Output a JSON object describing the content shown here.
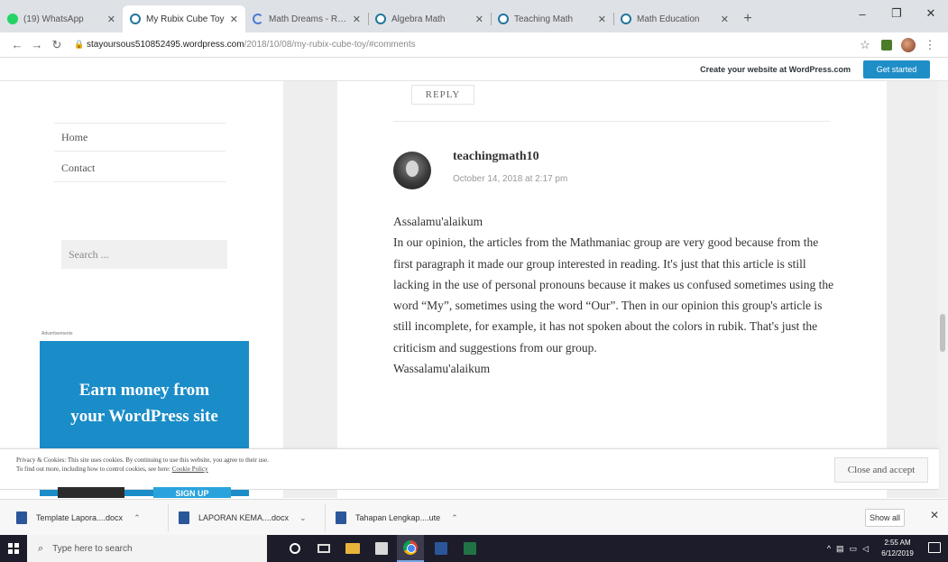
{
  "browser": {
    "tabs": [
      {
        "label": "(19) WhatsApp",
        "icon": "whatsapp-icon",
        "active": false
      },
      {
        "label": "My Rubix Cube Toy",
        "icon": "wordpress-icon",
        "active": true
      },
      {
        "label": "Math Dreams - Result",
        "icon": "loading-icon",
        "active": false
      },
      {
        "label": "Algebra Math",
        "icon": "wordpress-icon",
        "active": false
      },
      {
        "label": "Teaching Math",
        "icon": "wordpress-icon",
        "active": false
      },
      {
        "label": "Math Education",
        "icon": "wordpress-icon",
        "active": false
      }
    ],
    "url_host": "stayoursous510852495.wordpress.com",
    "url_path": "/2018/10/08/my-rubix-cube-toy/#comments"
  },
  "wpbar": {
    "cta": "Create your website at WordPress.com",
    "get_started": "Get started"
  },
  "sidebar": {
    "nav": [
      "Home",
      "Contact"
    ],
    "search_placeholder": "Search ...",
    "ad_label": "Advertisements",
    "ad_headline_1": "Earn money from",
    "ad_headline_2": "your WordPress site",
    "ad_btn_2": "SIGN UP"
  },
  "comment": {
    "reply_label": "REPLY",
    "author": "teachingmath10",
    "date": "October 14, 2018 at 2:17 pm",
    "greeting": "Assalamu'alaikum",
    "body": "In our opinion, the articles from the Mathmaniac group are very good because from the first paragraph it made our group interested in reading. It's just that this article is still lacking in the use of personal pronouns because it makes us confused sometimes using the word “My”, sometimes using the word “Our”. Then in our opinion this group's article is still incomplete, for example, it has not spoken about the colors in rubik. That's just the criticism and suggestions from our group.",
    "closing": "Wassalamu'alaikum"
  },
  "cookie": {
    "line1": "Privacy & Cookies: This site uses cookies. By continuing to use this website, you agree to their use.",
    "line2_prefix": "To find out more, including how to control cookies, see here: ",
    "line2_link": "Cookie Policy",
    "accept": "Close and accept"
  },
  "downloads": {
    "items": [
      "Template Lapora....docx",
      "LAPORAN KEMA....docx",
      "Tahapan Lengkap....ute"
    ],
    "show_all": "Show all"
  },
  "taskbar": {
    "search_placeholder": "Type here to search",
    "time": "2:55 AM",
    "date": "6/12/2019"
  }
}
